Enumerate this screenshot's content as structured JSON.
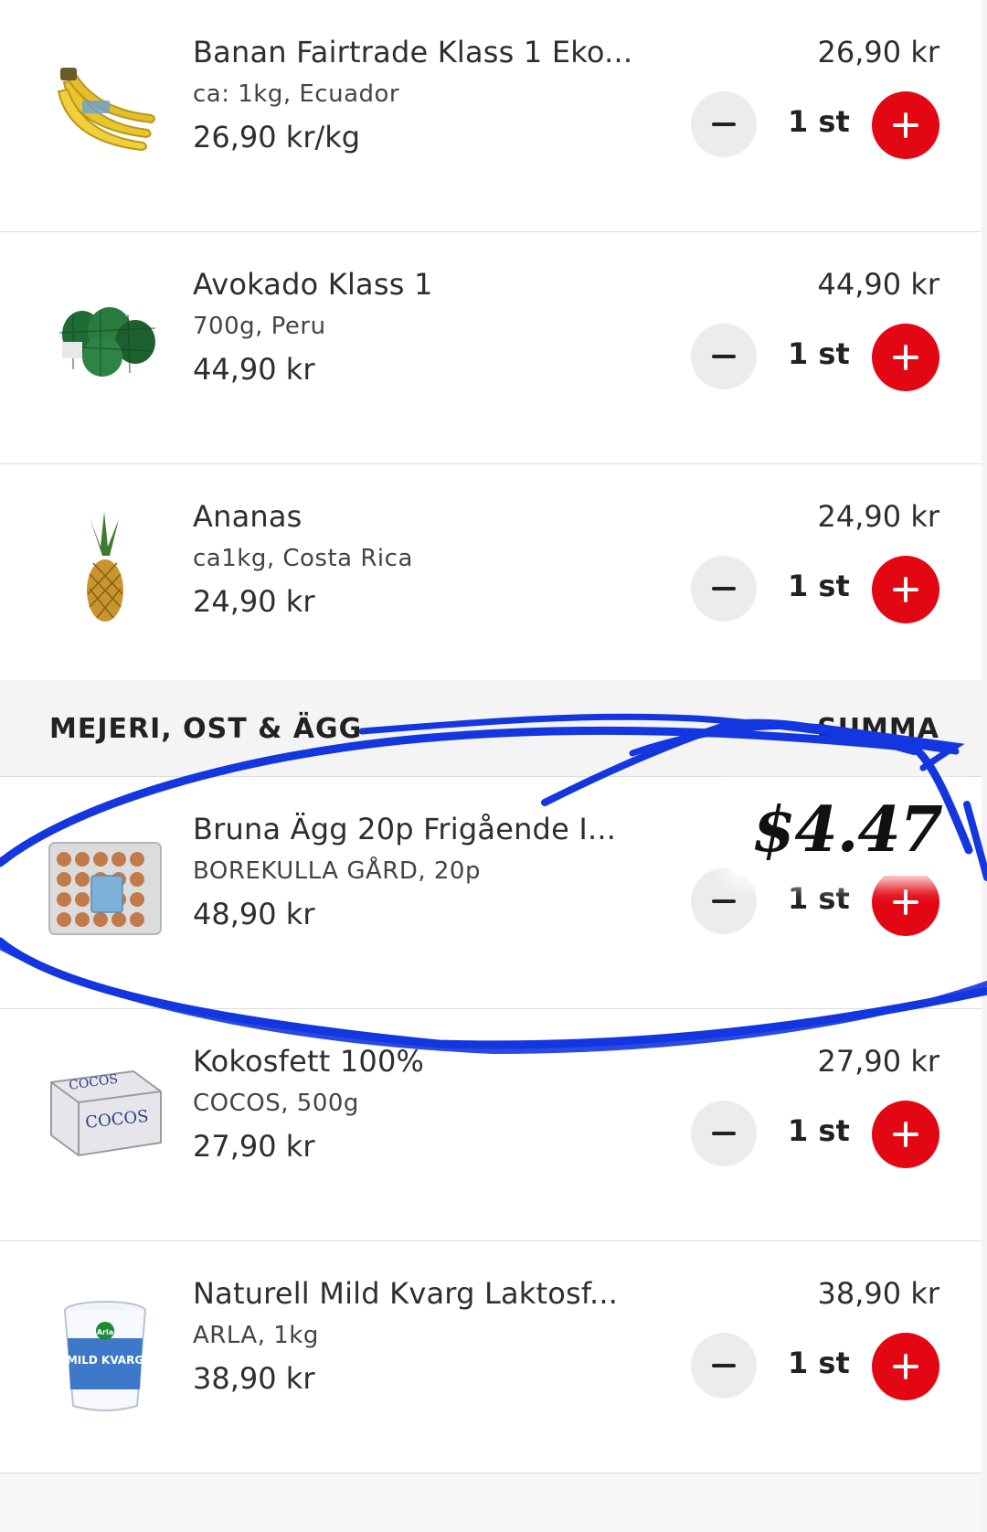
{
  "items": [
    {
      "name": "Banan Fairtrade Klass 1 Eko...",
      "detail": "ca: 1kg, Ecuador",
      "unit_price": "26,90 kr/kg",
      "total": "26,90 kr",
      "quantity": "1 st",
      "image": "banana-image"
    },
    {
      "name": "Avokado Klass 1",
      "detail": "700g, Peru",
      "unit_price": "44,90 kr",
      "total": "44,90 kr",
      "quantity": "1 st",
      "image": "avocado-image"
    },
    {
      "name": "Ananas",
      "detail": "ca1kg, Costa Rica",
      "unit_price": "24,90 kr",
      "total": "24,90 kr",
      "quantity": "1 st",
      "image": "pineapple-image"
    },
    {
      "name": "Bruna Ägg 20p Frigående I...",
      "detail": "BOREKULLA GÅRD, 20p",
      "unit_price": "48,90 kr",
      "total": "$4.47",
      "quantity": "1 st",
      "image": "eggs-image"
    },
    {
      "name": "Kokosfett 100%",
      "detail": "COCOS, 500g",
      "unit_price": "27,90 kr",
      "total": "27,90 kr",
      "quantity": "1 st",
      "image": "coconut-fat-image"
    },
    {
      "name": "Naturell Mild Kvarg Laktosf...",
      "detail": "ARLA, 1kg",
      "unit_price": "38,90 kr",
      "total": "38,90 kr",
      "quantity": "1 st",
      "image": "quark-image"
    }
  ],
  "section": {
    "title": "MEJERI, OST & ÄGG",
    "sum_label": "SUMMA"
  },
  "packaging_text": {
    "cocos": "COCOS",
    "kvarg": "MILD KVARG",
    "brand": "Arla"
  },
  "colors": {
    "accent": "#e30613",
    "minus_bg": "#ececec",
    "scribble": "#1336e0",
    "section_bg": "#f4f4f4"
  }
}
